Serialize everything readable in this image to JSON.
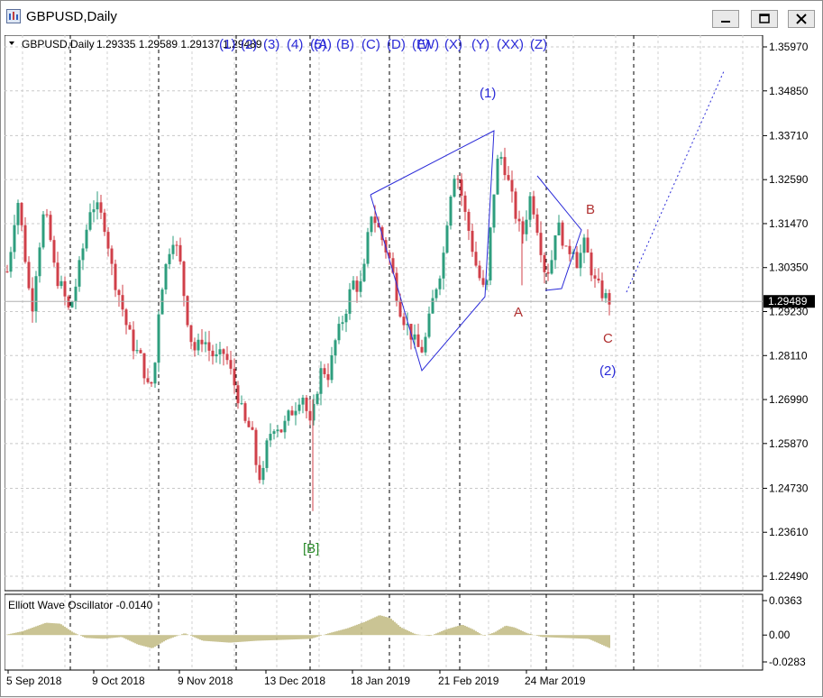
{
  "window": {
    "title": "GBPUSD,Daily",
    "buttons": [
      "minimize",
      "restore",
      "close"
    ]
  },
  "chart_info": {
    "symbol_tf": "GBPUSD,Daily",
    "ohlc": "1.29335 1.29589 1.29137 1.29489"
  },
  "current_price_label": "1.29489",
  "chart_data": {
    "type": "candlestick",
    "symbol": "GBPUSD",
    "timeframe": "Daily",
    "open": 1.29335,
    "high": 1.29589,
    "low": 1.29137,
    "close": 1.29489,
    "current_price": 1.29489,
    "ylim": [
      1.2192,
      1.3626
    ],
    "y_ticks": [
      1.3597,
      1.3485,
      1.3371,
      1.3259,
      1.3147,
      1.3035,
      1.2923,
      1.2811,
      1.2699,
      1.2587,
      1.2473,
      1.2361,
      1.2249
    ],
    "y_tick_labels": [
      "1.35970",
      "1.34850",
      "1.33710",
      "1.32590",
      "1.31470",
      "1.30350",
      "1.29230",
      "1.28110",
      "1.26990",
      "1.25870",
      "1.24730",
      "1.23610",
      "1.22490"
    ],
    "x_labels": [
      "5 Sep 2018",
      "9 Oct 2018",
      "9 Nov 2018",
      "13 Dec 2018",
      "18 Jan 2019",
      "21 Feb 2019",
      "24 Mar 2019"
    ],
    "wave_labels_top": [
      "(1)",
      "(2)",
      "(3)",
      "(4)",
      "(5)",
      "(A)",
      "(B)",
      "(C)",
      "(D)",
      "(E)",
      "(W)",
      "(X)",
      "(Y)",
      "(XX)",
      "(Z)"
    ],
    "annotations": [
      {
        "text": "(1)",
        "color": "#2b2bd8"
      },
      {
        "text": "(2)",
        "color": "#2b2bd8"
      },
      {
        "text": "A",
        "color": "#b03030"
      },
      {
        "text": "B",
        "color": "#b03030"
      },
      {
        "text": "C",
        "color": "#b03030"
      },
      {
        "text": "[B]",
        "color": "#2a8a2a"
      }
    ],
    "oscillator": {
      "label": "Elliott Wave Oscillator -0.0140",
      "value": -0.014,
      "ylim": [
        -0.0283,
        0.0363
      ],
      "y_tick_labels": [
        "0.0363",
        "0.00",
        "-0.0283"
      ],
      "y_ticks": [
        0.0363,
        0.0,
        -0.0283
      ]
    },
    "colors": {
      "bull": "#2e9e7e",
      "bear": "#d0404a",
      "wave_blue": "#2b2bd8",
      "wave_red": "#b03030",
      "wave_green": "#2a8a2a",
      "oscillator": "#b8b070"
    }
  }
}
